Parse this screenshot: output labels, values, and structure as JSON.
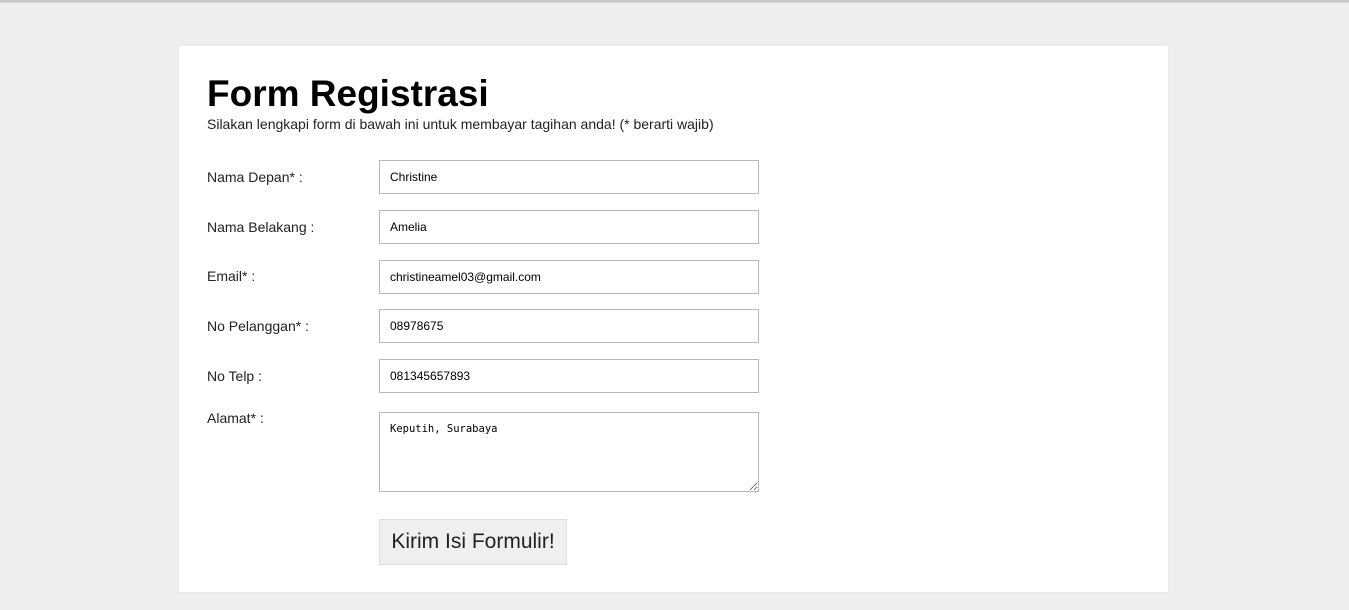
{
  "form": {
    "title": "Form Registrasi",
    "subtitle": "Silakan lengkapi form di bawah ini untuk membayar tagihan anda! (* berarti wajib)",
    "fields": [
      {
        "label": "Nama Depan* :",
        "value": "Christine"
      },
      {
        "label": "Nama Belakang :",
        "value": "Amelia"
      },
      {
        "label": "Email* :",
        "value": "christineamel03@gmail.com"
      },
      {
        "label": "No Pelanggan* :",
        "value": "08978675"
      },
      {
        "label": "No Telp :",
        "value": "081345657893"
      }
    ],
    "address": {
      "label": "Alamat* :",
      "value": "Keputih, Surabaya"
    },
    "submit_label": "Kirim Isi Formulir!"
  }
}
